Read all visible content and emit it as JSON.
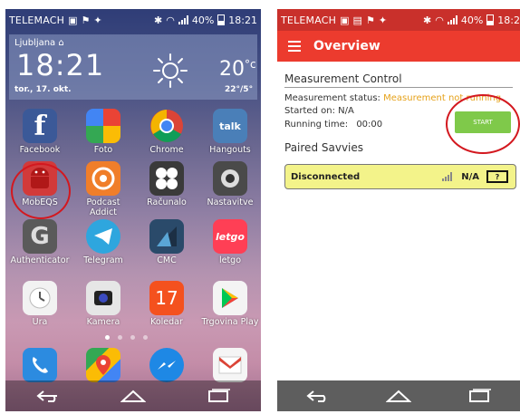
{
  "home": {
    "status": {
      "carrier": "TELEMACH",
      "battery": "40%",
      "time": "18:21"
    },
    "widget": {
      "city": "Ljubljana",
      "time": "18:21",
      "date": "tor., 17. okt.",
      "temp": "20",
      "temp_unit": "°c",
      "range": "22°/5°"
    },
    "apps": [
      {
        "label": "Facebook",
        "glyph": "f",
        "color": "#3b5998"
      },
      {
        "label": "Foto",
        "glyph": "",
        "color": "#e8a23c"
      },
      {
        "label": "Chrome",
        "glyph": "",
        "color": "#e8e8e8"
      },
      {
        "label": "Hangouts",
        "glyph": "talk",
        "color": "#4a7fb8"
      },
      {
        "label": "MobEQS",
        "glyph": "",
        "color": "#d23a3a"
      },
      {
        "label": "Podcast Addict",
        "glyph": "",
        "color": "#f07e2a"
      },
      {
        "label": "Računalo",
        "glyph": "",
        "color": "#3a3a3a"
      },
      {
        "label": "Nastavitve",
        "glyph": "",
        "color": "#4a4a4a"
      },
      {
        "label": "Authenticator",
        "glyph": "G",
        "color": "#5a5a5a"
      },
      {
        "label": "Telegram",
        "glyph": "",
        "color": "#2ea6de"
      },
      {
        "label": "CMC",
        "glyph": "",
        "color": "#2a4a6a"
      },
      {
        "label": "letgo",
        "glyph": "letgo",
        "color": "#ff3f55"
      },
      {
        "label": "Ura",
        "glyph": "",
        "color": "#f2f2f2"
      },
      {
        "label": "Kamera",
        "glyph": "",
        "color": "#e6e6e6"
      },
      {
        "label": "Koledar",
        "glyph": "17",
        "color": "#f4511e"
      },
      {
        "label": "Trgovina Play",
        "glyph": "",
        "color": "#f4f4f4"
      }
    ],
    "dock": [
      {
        "name": "phone",
        "color": "#2c8be0"
      },
      {
        "name": "maps",
        "color": "#34a853"
      },
      {
        "name": "messenger",
        "color": "#1e88e5"
      },
      {
        "name": "gmail",
        "color": "#f5f5f5"
      }
    ]
  },
  "app": {
    "status": {
      "carrier": "TELEMACH",
      "battery": "40%",
      "time": "18:2"
    },
    "title": "Overview",
    "measurement_control": "Measurement Control",
    "status_label": "Measurement status:",
    "status_value": "Measurement not running.",
    "started_label": "Started on:",
    "started_value": "N/A",
    "running_label": "Running time:",
    "running_value": "00:00",
    "start_button": "START",
    "paired": "Paired Savvies",
    "device": {
      "state": "Disconnected",
      "value": "N/A",
      "battery": "?"
    }
  }
}
